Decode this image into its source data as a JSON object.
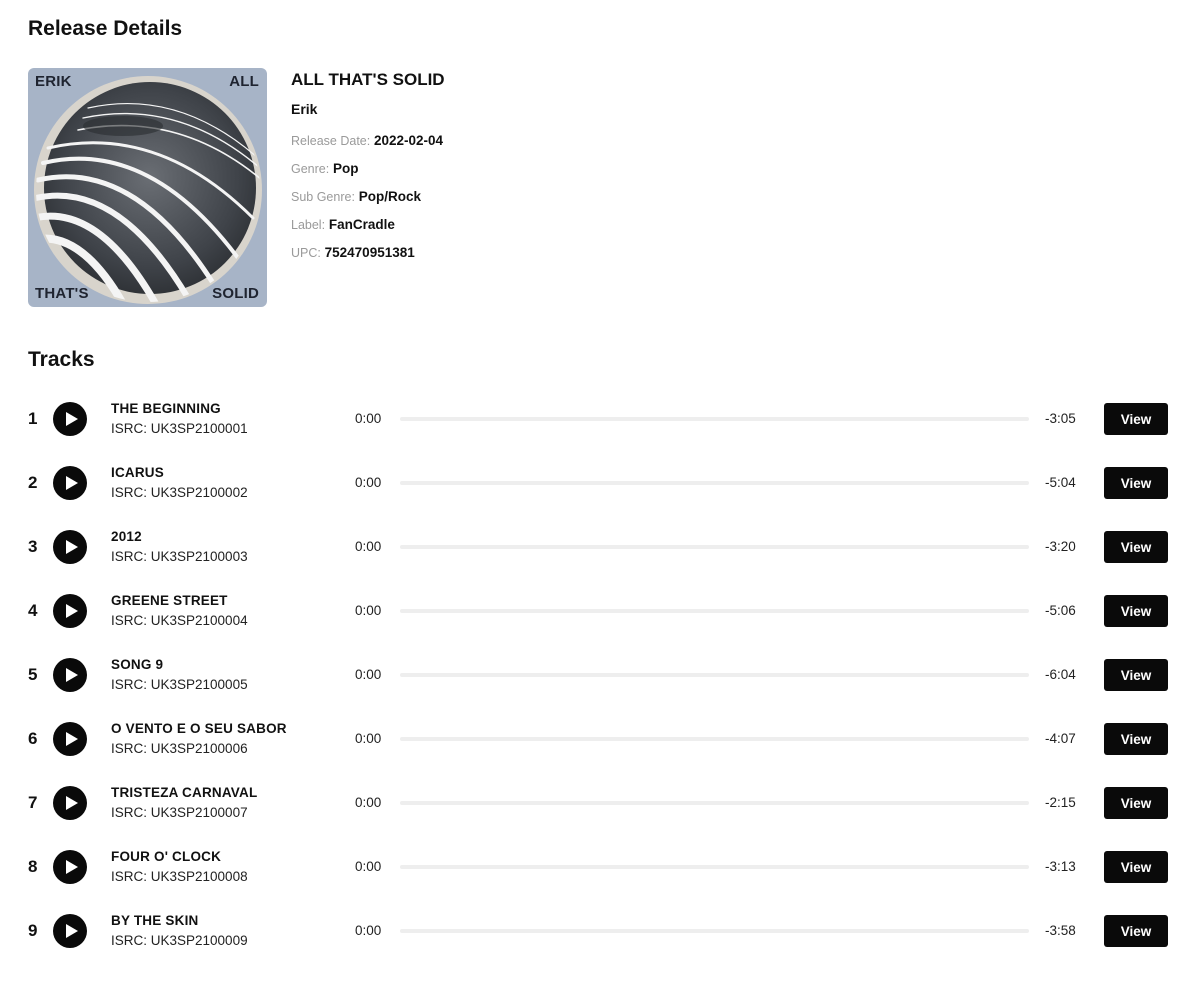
{
  "page": {
    "release_heading": "Release Details",
    "tracks_heading": "Tracks"
  },
  "cover": {
    "words": [
      "ERIK",
      "ALL",
      "THAT'S",
      "SOLID"
    ],
    "background_color": "#a7b4c7"
  },
  "release": {
    "title": "ALL THAT'S SOLID",
    "artist": "Erik",
    "fields": [
      {
        "label": "Release Date:",
        "value": "2022-02-04"
      },
      {
        "label": "Genre:",
        "value": "Pop"
      },
      {
        "label": "Sub Genre:",
        "value": "Pop/Rock"
      },
      {
        "label": "Label:",
        "value": "FanCradle"
      },
      {
        "label": "UPC:",
        "value": "752470951381"
      }
    ]
  },
  "tracks": [
    {
      "number": "1",
      "title": "THE BEGINNING",
      "isrc": "ISRC: UK3SP2100001",
      "current": "0:00",
      "remaining": "-3:05",
      "progress": 0,
      "button": "View"
    },
    {
      "number": "2",
      "title": "ICARUS",
      "isrc": "ISRC: UK3SP2100002",
      "current": "0:00",
      "remaining": "-5:04",
      "progress": 0,
      "button": "View"
    },
    {
      "number": "3",
      "title": "2012",
      "isrc": "ISRC: UK3SP2100003",
      "current": "0:00",
      "remaining": "-3:20",
      "progress": 0,
      "button": "View"
    },
    {
      "number": "4",
      "title": "GREENE STREET",
      "isrc": "ISRC: UK3SP2100004",
      "current": "0:00",
      "remaining": "-5:06",
      "progress": 0,
      "button": "View"
    },
    {
      "number": "5",
      "title": "SONG 9",
      "isrc": "ISRC: UK3SP2100005",
      "current": "0:00",
      "remaining": "-6:04",
      "progress": 0,
      "button": "View"
    },
    {
      "number": "6",
      "title": "O VENTO E O SEU SABOR",
      "isrc": "ISRC: UK3SP2100006",
      "current": "0:00",
      "remaining": "-4:07",
      "progress": 0,
      "button": "View"
    },
    {
      "number": "7",
      "title": "TRISTEZA CARNAVAL",
      "isrc": "ISRC: UK3SP2100007",
      "current": "0:00",
      "remaining": "-2:15",
      "progress": 0,
      "button": "View"
    },
    {
      "number": "8",
      "title": "FOUR O' CLOCK",
      "isrc": "ISRC: UK3SP2100008",
      "current": "0:00",
      "remaining": "-3:13",
      "progress": 0,
      "button": "View"
    },
    {
      "number": "9",
      "title": "BY THE SKIN",
      "isrc": "ISRC: UK3SP2100009",
      "current": "0:00",
      "remaining": "-3:58",
      "progress": 0,
      "button": "View"
    }
  ],
  "icons": {
    "play": "play-icon"
  }
}
